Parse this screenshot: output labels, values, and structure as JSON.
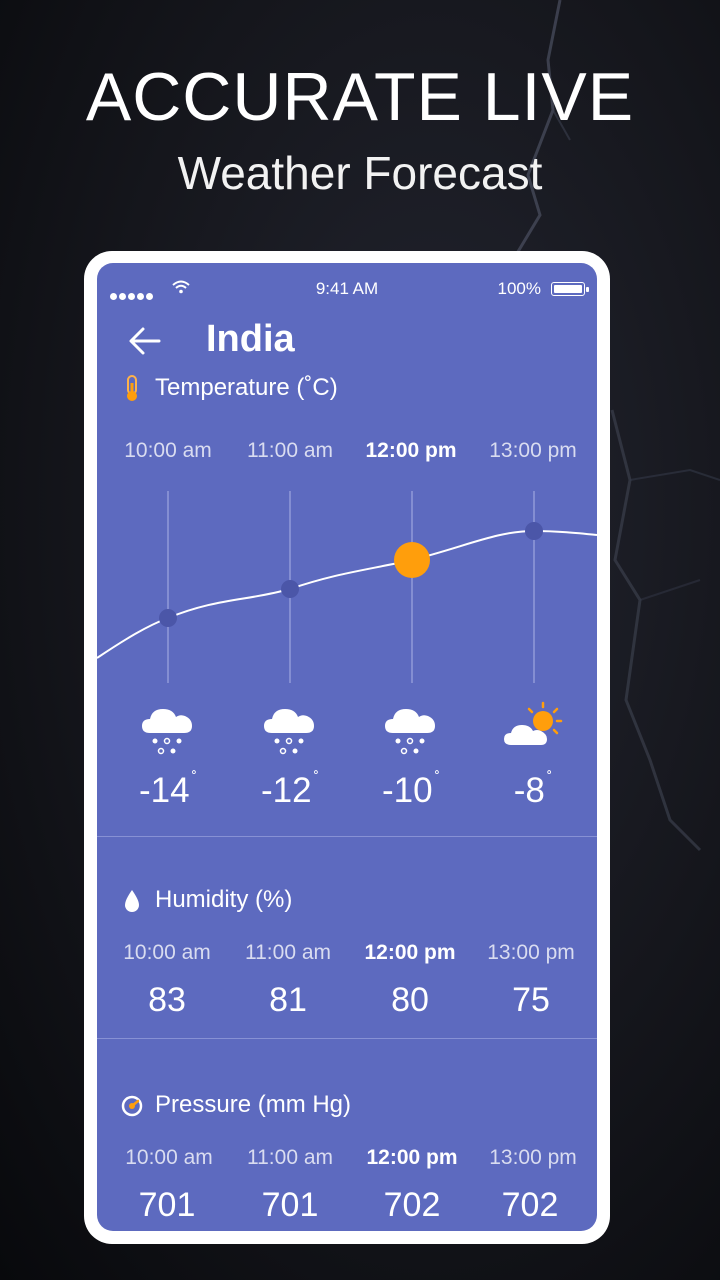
{
  "promo": {
    "headline": "ACCURATE LIVE",
    "subline": "Weather Forecast"
  },
  "status_bar": {
    "time": "9:41 AM",
    "battery": "100%"
  },
  "header": {
    "city": "India"
  },
  "temperature": {
    "title": "Temperature (˚C)",
    "times": [
      "10:00 am",
      "11:00 am",
      "12:00 pm",
      "13:00 pm"
    ],
    "active_index": 2,
    "values": [
      "-14",
      "-12",
      "-10",
      "-8"
    ],
    "degree": "˚",
    "conditions": [
      "snow-cloud-icon",
      "snow-cloud-icon",
      "snow-cloud-icon",
      "partly-sunny-icon"
    ],
    "colors": {
      "highlight": "#ff9e0c",
      "background": "#5d6abf"
    }
  },
  "humidity": {
    "title": "Humidity (%)",
    "times": [
      "10:00 am",
      "11:00 am",
      "12:00 pm",
      "13:00 pm"
    ],
    "values": [
      "83",
      "81",
      "80",
      "75"
    ]
  },
  "pressure": {
    "title": "Pressure (mm Hg)",
    "times": [
      "10:00 am",
      "11:00 am",
      "12:00 pm",
      "13:00 pm"
    ],
    "values": [
      "701",
      "701",
      "702",
      "702"
    ]
  },
  "chart_data": {
    "type": "line",
    "categories": [
      "10:00 am",
      "11:00 am",
      "12:00 pm",
      "13:00 pm"
    ],
    "series": [
      {
        "values": [
          -14,
          -12,
          -10,
          -8
        ]
      }
    ]
  }
}
